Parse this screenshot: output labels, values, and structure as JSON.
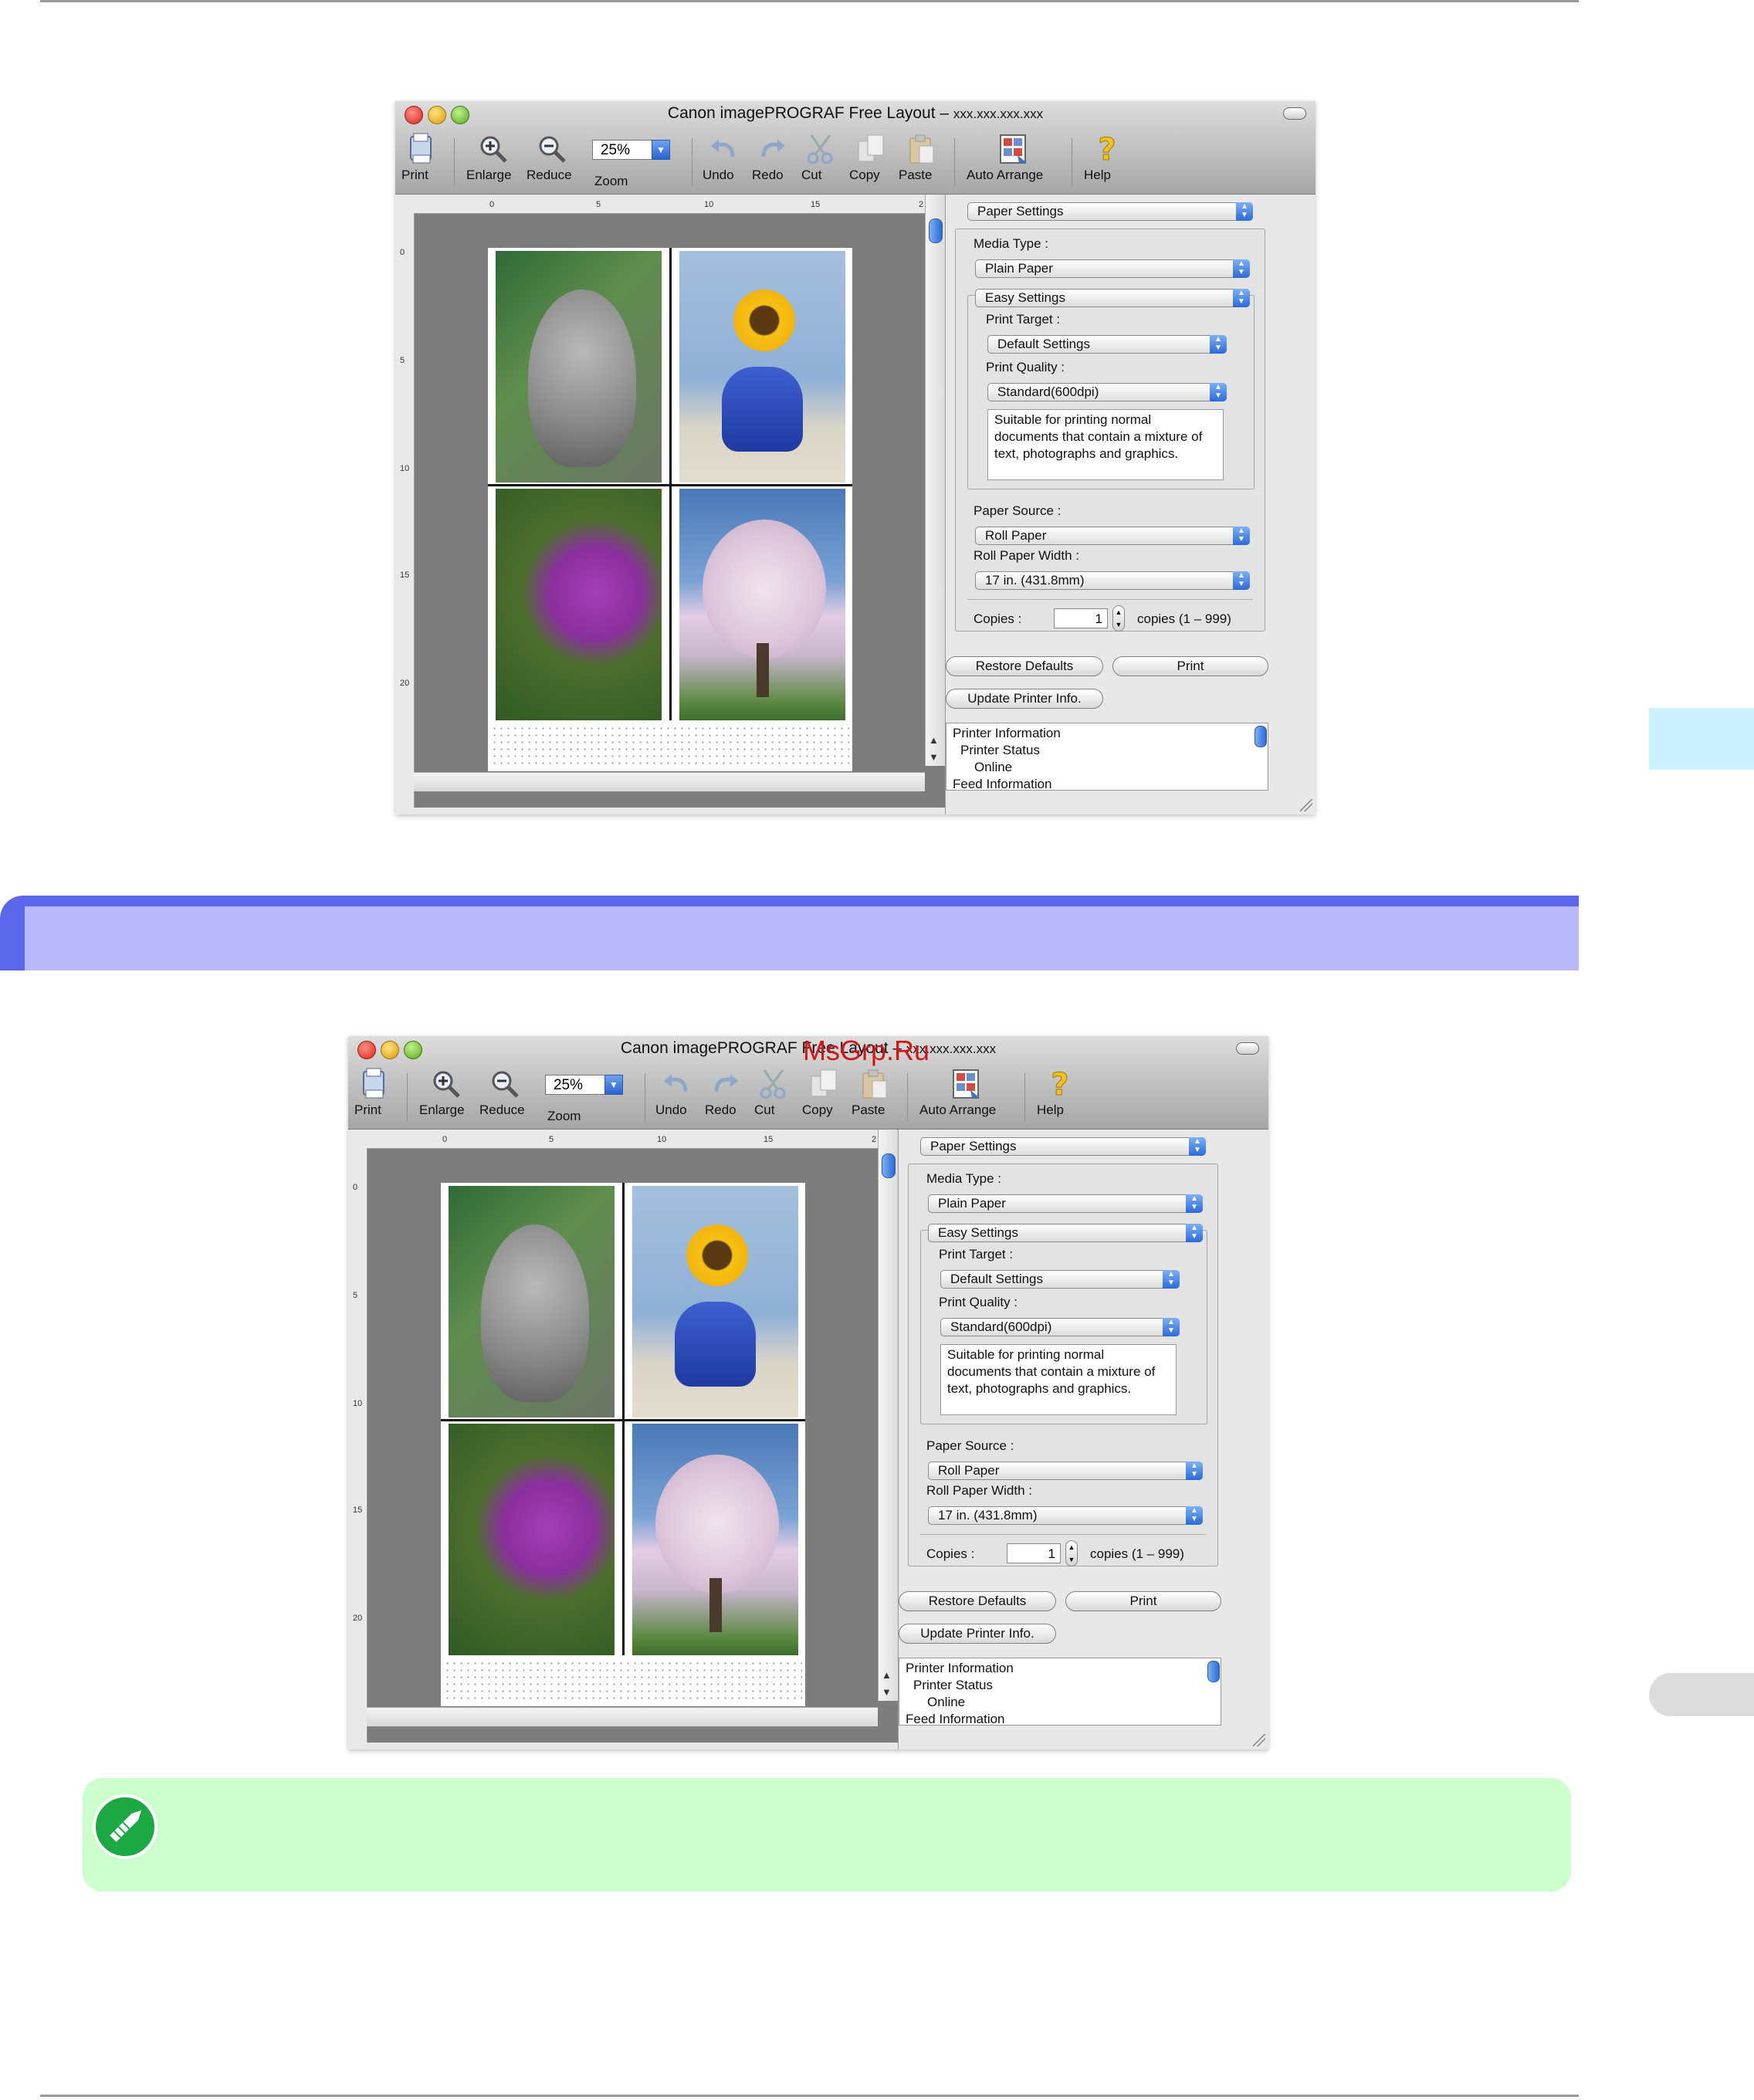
{
  "watermark": "MsGrp.Ru",
  "windows": [
    {
      "title": "Canon imagePROGRAF Free Layout –",
      "title_address": "xxx.xxx.xxx.xxx",
      "toolbar": {
        "print": "Print",
        "enlarge": "Enlarge",
        "reduce": "Reduce",
        "zoom_value": "25%",
        "zoom": "Zoom",
        "undo": "Undo",
        "redo": "Redo",
        "cut": "Cut",
        "copy": "Copy",
        "paste": "Paste",
        "auto_arrange": "Auto Arrange",
        "help": "Help"
      },
      "ruler": {
        "top": [
          "0",
          "5",
          "10",
          "15",
          "2"
        ],
        "left": [
          "0",
          "5",
          "10",
          "15",
          "20"
        ]
      },
      "panel": {
        "settings_selector": "Paper Settings",
        "media_type_label": "Media Type :",
        "media_type_value": "Plain Paper",
        "mode": "Easy Settings",
        "print_target_label": "Print Target :",
        "print_target_value": "Default Settings",
        "print_quality_label": "Print Quality :",
        "print_quality_value": "Standard(600dpi)",
        "description": "Suitable for printing normal documents that contain a mixture of text, photographs and graphics.",
        "paper_source_label": "Paper Source :",
        "paper_source_value": "Roll Paper",
        "roll_width_label": "Roll Paper Width :",
        "roll_width_value": "17 in. (431.8mm)",
        "copies_label": "Copies :",
        "copies_value": "1",
        "copies_range": "copies (1 – 999)",
        "restore_defaults": "Restore Defaults",
        "print_button": "Print",
        "update_info": "Update Printer Info.",
        "info_lines": [
          "Printer Information",
          "Printer Status",
          "Online",
          "Feed Information"
        ]
      }
    },
    {
      "title": "Canon imagePROGRAF Free Layout –",
      "title_address": "xxx.xxx.xxx.xxx",
      "toolbar": {
        "print": "Print",
        "enlarge": "Enlarge",
        "reduce": "Reduce",
        "zoom_value": "25%",
        "zoom": "Zoom",
        "undo": "Undo",
        "redo": "Redo",
        "cut": "Cut",
        "copy": "Copy",
        "paste": "Paste",
        "auto_arrange": "Auto Arrange",
        "help": "Help"
      },
      "ruler": {
        "top": [
          "0",
          "5",
          "10",
          "15",
          "2"
        ],
        "left": [
          "0",
          "5",
          "10",
          "15",
          "20"
        ]
      },
      "panel": {
        "settings_selector": "Paper Settings",
        "media_type_label": "Media Type :",
        "media_type_value": "Plain Paper",
        "mode": "Easy Settings",
        "print_target_label": "Print Target :",
        "print_target_value": "Default Settings",
        "print_quality_label": "Print Quality :",
        "print_quality_value": "Standard(600dpi)",
        "description": "Suitable for printing normal documents that contain a mixture of text, photographs and graphics.",
        "paper_source_label": "Paper Source :",
        "paper_source_value": "Roll Paper",
        "roll_width_label": "Roll Paper Width :",
        "roll_width_value": "17 in. (431.8mm)",
        "copies_label": "Copies :",
        "copies_value": "1",
        "copies_range": "copies (1 – 999)",
        "restore_defaults": "Restore Defaults",
        "print_button": "Print",
        "update_info": "Update Printer Info.",
        "info_lines": [
          "Printer Information",
          "Printer Status",
          "Online",
          "Feed Information"
        ]
      }
    }
  ],
  "colors": {
    "section_band": "#5b67ea",
    "section_band_light": "#b8b9fb",
    "note_bg": "#ccffcc",
    "side_tab": "#ccf3ff"
  },
  "icons": {
    "print": "printer-icon",
    "enlarge": "zoom-in-icon",
    "reduce": "zoom-out-icon",
    "undo": "undo-icon",
    "redo": "redo-icon",
    "cut": "scissors-icon",
    "copy": "copy-icon",
    "paste": "clipboard-icon",
    "auto_arrange": "auto-arrange-icon",
    "help": "question-icon",
    "note": "pencil-note-icon"
  }
}
